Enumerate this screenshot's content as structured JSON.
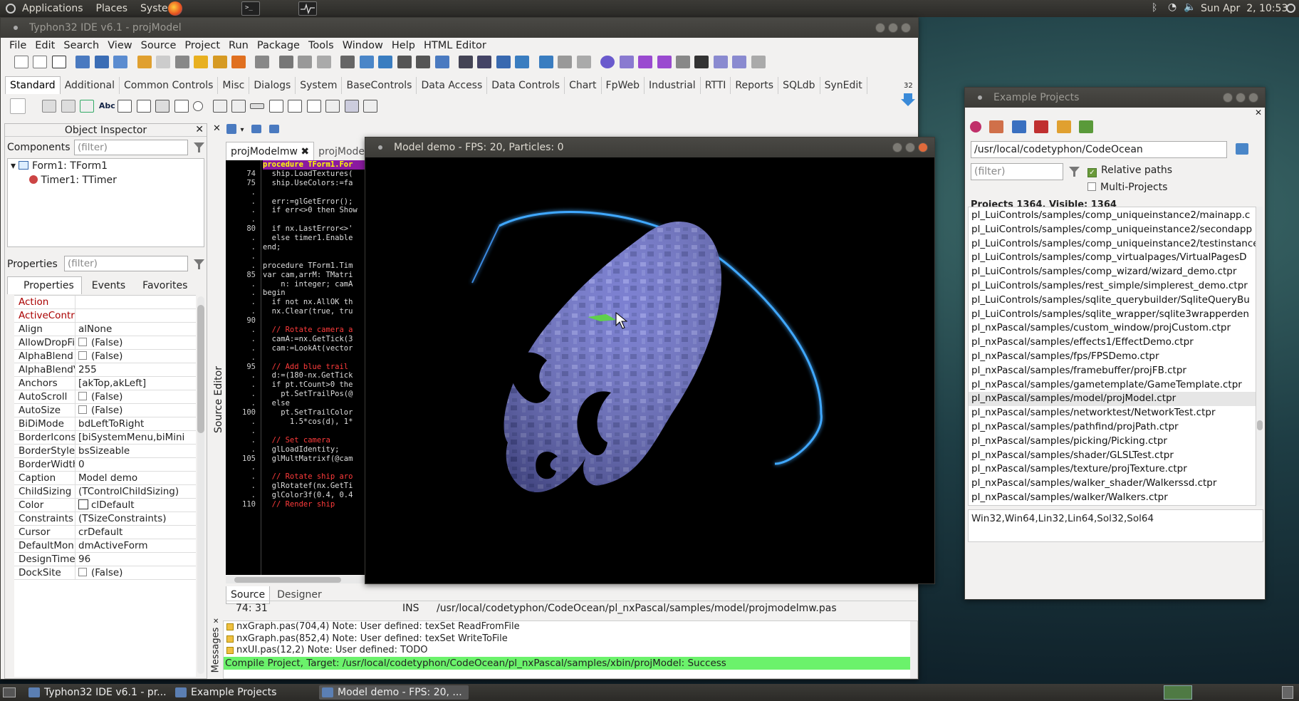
{
  "top_panel": {
    "menus": [
      "Applications",
      "Places",
      "System"
    ],
    "clock": "Sun Apr  2, 10:53"
  },
  "ide": {
    "title": "Typhon32 IDE v6.1 - projModel",
    "menu": [
      "File",
      "Edit",
      "Search",
      "View",
      "Source",
      "Project",
      "Run",
      "Package",
      "Tools",
      "Window",
      "Help",
      "HTML Editor"
    ],
    "palette_tabs": [
      "Standard",
      "Additional",
      "Common Controls",
      "Misc",
      "Dialogs",
      "System",
      "BaseControls",
      "Data Access",
      "Data Controls",
      "Chart",
      "FpWeb",
      "Industrial",
      "RTTI",
      "Reports",
      "SQLdb",
      "SynEdit"
    ],
    "palette_count": "32"
  },
  "object_inspector": {
    "title": "Object Inspector",
    "components_label": "Components",
    "components_filter": "(filter)",
    "tree": [
      "Form1: TForm1",
      "Timer1: TTimer"
    ],
    "properties_label": "Properties",
    "properties_filter": "(filter)",
    "tabs": [
      "Properties",
      "Events",
      "Favorites"
    ],
    "rows": [
      {
        "name": "Action",
        "value": "",
        "hl": true
      },
      {
        "name": "ActiveControl",
        "value": "",
        "hl": true
      },
      {
        "name": "Align",
        "value": "alNone"
      },
      {
        "name": "AllowDropFiles",
        "value": "(False)",
        "check": true
      },
      {
        "name": "AlphaBlend",
        "value": "(False)",
        "check": true
      },
      {
        "name": "AlphaBlendValue",
        "value": "255"
      },
      {
        "name": "Anchors",
        "value": "[akTop,akLeft]",
        "expand": true
      },
      {
        "name": "AutoScroll",
        "value": "(False)",
        "check": true
      },
      {
        "name": "AutoSize",
        "value": "(False)",
        "check": true
      },
      {
        "name": "BiDiMode",
        "value": "bdLeftToRight"
      },
      {
        "name": "BorderIcons",
        "value": "[biSystemMenu,biMini",
        "expand": true
      },
      {
        "name": "BorderStyle",
        "value": "bsSizeable"
      },
      {
        "name": "BorderWidth",
        "value": "0"
      },
      {
        "name": "Caption",
        "value": "Model demo"
      },
      {
        "name": "ChildSizing",
        "value": "(TControlChildSizing)",
        "expand": true
      },
      {
        "name": "Color",
        "value": "clDefault",
        "swatch": true
      },
      {
        "name": "Constraints",
        "value": "(TSizeConstraints)",
        "expand": true
      },
      {
        "name": "Cursor",
        "value": "crDefault"
      },
      {
        "name": "DefaultMonitor",
        "value": "dmActiveForm"
      },
      {
        "name": "DesignTimePPI",
        "value": "96"
      },
      {
        "name": "DockSite",
        "value": "(False)",
        "check": true
      }
    ]
  },
  "source_editor": {
    "side_label": "Source Editor",
    "tabs": [
      "projModelmw",
      "projMode"
    ],
    "bottom_tabs": [
      "Source",
      "Designer"
    ],
    "status_pos": "74: 31",
    "status_mode": "INS",
    "status_path": "/usr/local/codetyphon/CodeOcean/pl_nxPascal/samples/model/projmodelmw.pas",
    "gutter": [
      "",
      "74",
      "75",
      ".",
      ".",
      ".",
      ".",
      "80",
      ".",
      ".",
      ".",
      ".",
      "85",
      ".",
      ".",
      ".",
      ".",
      "90",
      ".",
      ".",
      ".",
      ".",
      "95",
      ".",
      ".",
      ".",
      ".",
      "100",
      ".",
      ".",
      ".",
      ".",
      "105",
      ".",
      ".",
      ".",
      ".",
      "110"
    ],
    "lines": [
      {
        "t": "procedure TForm1.For",
        "c": "hl"
      },
      {
        "t": "  ship.LoadTextures(",
        "c": ""
      },
      {
        "t": "  ship.UseColors:=fa",
        "c": ""
      },
      {
        "t": "",
        "c": ""
      },
      {
        "t": "  err:=glGetError();",
        "c": ""
      },
      {
        "t": "  if err<>0 then Show",
        "c": ""
      },
      {
        "t": "",
        "c": ""
      },
      {
        "t": "  if nx.LastError<>'",
        "c": ""
      },
      {
        "t": "  else timer1.Enable",
        "c": ""
      },
      {
        "t": "end;",
        "c": ""
      },
      {
        "t": "",
        "c": ""
      },
      {
        "t": "procedure TForm1.Tim",
        "c": ""
      },
      {
        "t": "var cam,arrM: TMatri",
        "c": ""
      },
      {
        "t": "    n: integer; camA",
        "c": ""
      },
      {
        "t": "begin",
        "c": ""
      },
      {
        "t": "  if not nx.AllOK th",
        "c": ""
      },
      {
        "t": "  nx.Clear(true, tru",
        "c": ""
      },
      {
        "t": "",
        "c": ""
      },
      {
        "t": "  // Rotate camera a",
        "c": "cm"
      },
      {
        "t": "  camA:=nx.GetTick(3",
        "c": ""
      },
      {
        "t": "  cam:=LookAt(vector",
        "c": ""
      },
      {
        "t": "",
        "c": ""
      },
      {
        "t": "  // Add blue trail",
        "c": "cm"
      },
      {
        "t": "  d:=(180-nx.GetTick",
        "c": ""
      },
      {
        "t": "  if pt.tCount>0 the",
        "c": ""
      },
      {
        "t": "    pt.SetTrailPos(@",
        "c": ""
      },
      {
        "t": "  else",
        "c": ""
      },
      {
        "t": "    pt.SetTrailColor",
        "c": ""
      },
      {
        "t": "      1.5*cos(d), 1*",
        "c": ""
      },
      {
        "t": "",
        "c": ""
      },
      {
        "t": "  // Set camera",
        "c": "cm"
      },
      {
        "t": "  glLoadIdentity;",
        "c": ""
      },
      {
        "t": "  glMultMatrixf(@cam",
        "c": ""
      },
      {
        "t": "",
        "c": ""
      },
      {
        "t": "  // Rotate ship aro",
        "c": "cm"
      },
      {
        "t": "  glRotatef(nx.GetTi",
        "c": ""
      },
      {
        "t": "  glColor3f(0.4, 0.4",
        "c": ""
      },
      {
        "t": "  // Render ship",
        "c": "cm"
      }
    ]
  },
  "messages": {
    "side_label": "Messages",
    "lines": [
      "nxGraph.pas(704,4) Note: User defined: texSet ReadFromFile",
      "nxGraph.pas(852,4) Note: User defined: texSet WriteToFile",
      "nxUI.pas(12,2) Note: User defined: TODO"
    ],
    "status": "Compile Project, Target: /usr/local/codetyphon/CodeOcean/pl_nxPascal/samples/xbin/projModel: Success"
  },
  "model_demo": {
    "title": "Model demo - FPS: 20, Particles: 0"
  },
  "example_projects": {
    "title": "Example Projects",
    "path": "/usr/local/codetyphon/CodeOcean",
    "filter": "(filter)",
    "relative_paths_label": "Relative paths",
    "multi_projects_label": "Multi-Projects",
    "counts": "Projects 1364, Visible: 1364",
    "selected_index": 13,
    "items": [
      "pl_LuiControls/samples/comp_uniqueinstance2/mainapp.c",
      "pl_LuiControls/samples/comp_uniqueinstance2/secondapp",
      "pl_LuiControls/samples/comp_uniqueinstance2/testinstance",
      "pl_LuiControls/samples/comp_virtualpages/VirtualPagesD",
      "pl_LuiControls/samples/comp_wizard/wizard_demo.ctpr",
      "pl_LuiControls/samples/rest_simple/simplerest_demo.ctpr",
      "pl_LuiControls/samples/sqlite_querybuilder/SqliteQueryBu",
      "pl_LuiControls/samples/sqlite_wrapper/sqlite3wrapperden",
      "pl_nxPascal/samples/custom_window/projCustom.ctpr",
      "pl_nxPascal/samples/effects1/EffectDemo.ctpr",
      "pl_nxPascal/samples/fps/FPSDemo.ctpr",
      "pl_nxPascal/samples/framebuffer/projFB.ctpr",
      "pl_nxPascal/samples/gametemplate/GameTemplate.ctpr",
      "pl_nxPascal/samples/model/projModel.ctpr",
      "pl_nxPascal/samples/networktest/NetworkTest.ctpr",
      "pl_nxPascal/samples/pathfind/projPath.ctpr",
      "pl_nxPascal/samples/picking/Picking.ctpr",
      "pl_nxPascal/samples/shader/GLSLTest.ctpr",
      "pl_nxPascal/samples/texture/projTexture.ctpr",
      "pl_nxPascal/samples/walker_shader/Walkerssd.ctpr",
      "pl_nxPascal/samples/walker/Walkers.ctpr"
    ],
    "targets": "Win32,Win64,Lin32,Lin64,Sol32,Sol64"
  },
  "taskbar": {
    "tasks": [
      "Typhon32 IDE v6.1 - pr...",
      "Example Projects",
      "Model demo - FPS: 20, ..."
    ]
  },
  "colors": {
    "ide_bg": "#f2f1f0",
    "editor_bg": "#000000",
    "comment": "#ff3b3b",
    "highlight_line": "#8b1aa0",
    "success": "#6bf26b",
    "ship": "#6a6fcb"
  }
}
